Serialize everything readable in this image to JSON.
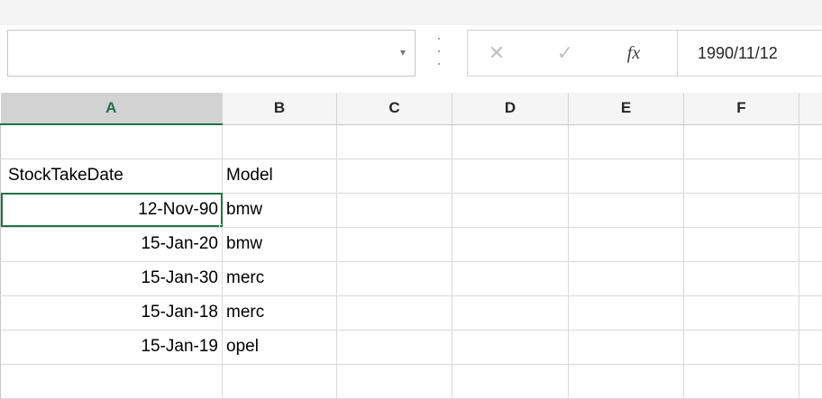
{
  "formula_bar": {
    "name_box_value": "",
    "dropdown_glyph": "▾",
    "cancel_glyph": "✕",
    "enter_glyph": "✓",
    "fx_glyph": "fx",
    "formula_value": "1990/11/12"
  },
  "columns": [
    "A",
    "B",
    "C",
    "D",
    "E",
    "F"
  ],
  "selected_column": "A",
  "rows": [
    [
      "",
      "",
      "",
      "",
      "",
      ""
    ],
    [
      "StockTakeDate",
      "Model",
      "",
      "",
      "",
      ""
    ],
    [
      "12-Nov-90",
      "bmw",
      "",
      "",
      "",
      ""
    ],
    [
      "15-Jan-20",
      "bmw",
      "",
      "",
      "",
      ""
    ],
    [
      "15-Jan-30",
      "merc",
      "",
      "",
      "",
      ""
    ],
    [
      "15-Jan-18",
      "merc",
      "",
      "",
      "",
      ""
    ],
    [
      "15-Jan-19",
      "opel",
      "",
      "",
      "",
      ""
    ],
    [
      "",
      "",
      "",
      "",
      "",
      ""
    ]
  ],
  "active_cell": "A3",
  "colors": {
    "accent": "#217346"
  }
}
